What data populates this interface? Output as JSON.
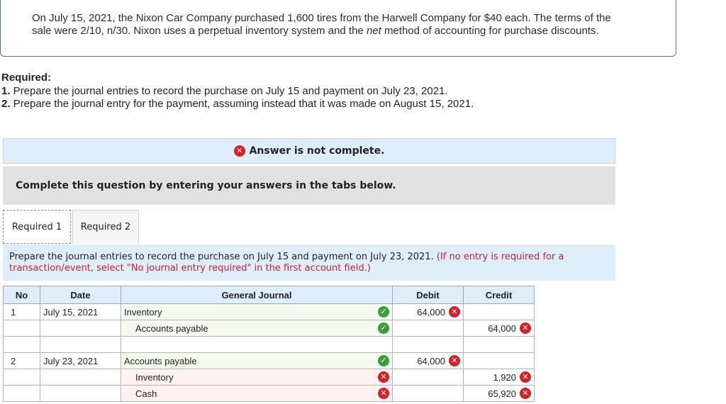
{
  "problem": {
    "line1": "On July 15, 2021, the Nixon Car Company purchased 1,600 tires from the Harwell Company for $40 each. The terms of the",
    "line2_before": "sale were 2/10, n/30. Nixon uses a perpetual inventory system and the ",
    "line2_em": "net",
    "line2_after": " method of accounting for purchase discounts."
  },
  "required": {
    "heading": "Required:",
    "items": [
      {
        "num": "1.",
        "text": " Prepare the journal entries to record the purchase on July 15 and payment on July 23, 2021."
      },
      {
        "num": "2.",
        "text": " Prepare the journal entry for the payment, assuming instead that it was made on August 15, 2021."
      }
    ]
  },
  "banner": {
    "icon": "x-circle-icon",
    "text": "Answer is not complete."
  },
  "complete_prompt": "Complete this question by entering your answers in the tabs below.",
  "tabs": [
    {
      "label": "Required 1",
      "active": true
    },
    {
      "label": "Required 2",
      "active": false
    }
  ],
  "instruction": {
    "text": "Prepare the journal entries to record the purchase on July 15 and payment on July 23, 2021.",
    "note": "(If no entry is required for a transaction/event, select \"No journal entry required\" in the first account field.)"
  },
  "table": {
    "headers": [
      "No",
      "Date",
      "General Journal",
      "Debit",
      "Credit"
    ],
    "rows": [
      {
        "no": "1",
        "date": "July 15, 2021",
        "account": "Inventory",
        "indent": false,
        "status": "correct",
        "debit": "64,000",
        "debit_status": "wrong",
        "credit": "",
        "credit_status": ""
      },
      {
        "no": "",
        "date": "",
        "account": "Accounts payable",
        "indent": true,
        "status": "correct",
        "debit": "",
        "debit_status": "",
        "credit": "64,000",
        "credit_status": "wrong"
      },
      {
        "no": "",
        "date": "",
        "account": "",
        "indent": false,
        "status": "",
        "debit": "",
        "debit_status": "",
        "credit": "",
        "credit_status": ""
      },
      {
        "no": "2",
        "date": "July 23, 2021",
        "account": "Accounts payable",
        "indent": false,
        "status": "correct",
        "debit": "64,000",
        "debit_status": "wrong",
        "credit": "",
        "credit_status": ""
      },
      {
        "no": "",
        "date": "",
        "account": "Inventory",
        "indent": true,
        "status": "wrong",
        "debit": "",
        "debit_status": "",
        "credit": "1,920",
        "credit_status": "wrong"
      },
      {
        "no": "",
        "date": "",
        "account": "Cash",
        "indent": true,
        "status": "wrong",
        "debit": "",
        "debit_status": "",
        "credit": "65,920",
        "credit_status": "wrong"
      }
    ]
  },
  "colors": {
    "correct": "#3a9e3a",
    "wrong": "#d61f26",
    "header_bg": "#ddeefa"
  }
}
